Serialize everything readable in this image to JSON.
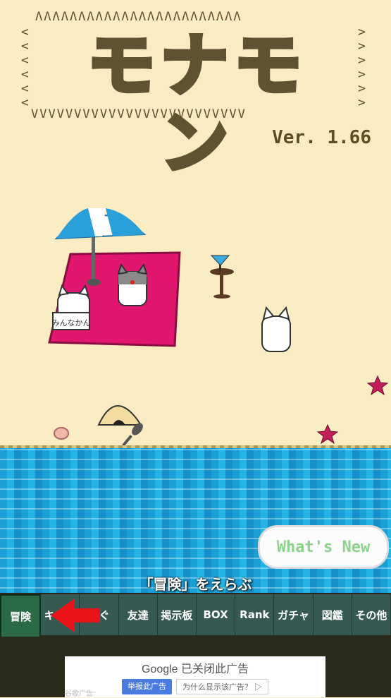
{
  "title": {
    "logo_text": "モナモン",
    "version": "Ver. 1.66"
  },
  "scene": {
    "whats_new_label": "What's New",
    "sign_text": "みんなかん"
  },
  "instruction": "「冒険」をえらぶ",
  "nav": {
    "items": [
      {
        "label": "冒険",
        "active": true
      },
      {
        "label": "キャラ",
        "active": false
      },
      {
        "label": "らぐ",
        "active": false
      },
      {
        "label": "友達",
        "active": false
      },
      {
        "label": "掲示板",
        "active": false
      },
      {
        "label": "BOX",
        "active": false
      },
      {
        "label": "Rank",
        "active": false
      },
      {
        "label": "ガチャ",
        "active": false
      },
      {
        "label": "図鑑",
        "active": false
      },
      {
        "label": "その他",
        "active": false
      }
    ]
  },
  "ad": {
    "title": "Google 已关闭此广告",
    "report_label": "举报此广告",
    "why_label": "为什么显示该广告？ ▷",
    "corner": "谷歌广告"
  },
  "colors": {
    "sand": "#f9ecc3",
    "logo_outline": "#5e5230",
    "towel": "#e0166f",
    "ocean": "#1aa0d6",
    "nav_bg": "#365a52",
    "nav_active": "#2a6b46",
    "arrow": "#e8141a",
    "starfish": "#c21f5a"
  }
}
